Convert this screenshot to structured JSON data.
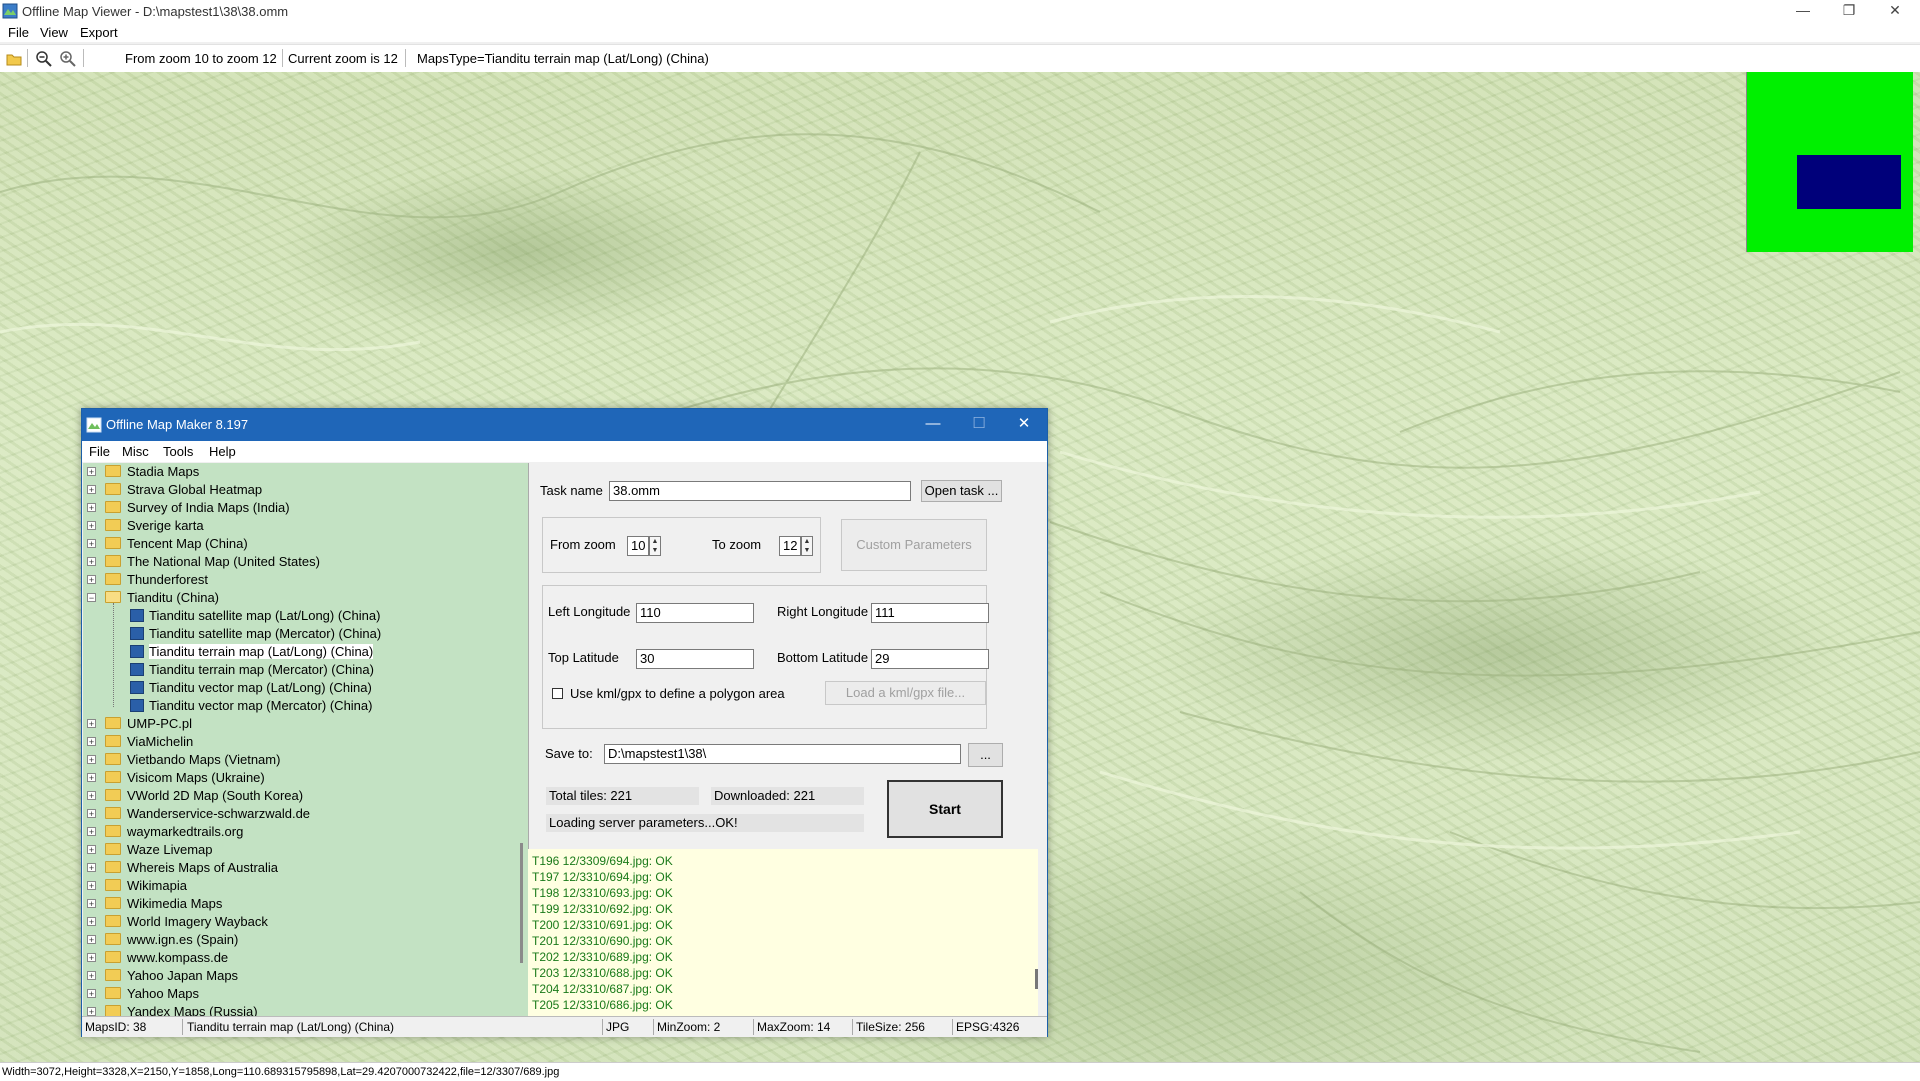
{
  "main_window": {
    "title": "Offline Map Viewer - D:\\mapstest1\\38\\38.omm",
    "menu": [
      "File",
      "View",
      "Export"
    ],
    "toolbar": {
      "zoom_range": "From zoom 10 to zoom 12",
      "current_zoom": "Current zoom is 12",
      "maps_type": "MapsType=Tianditu terrain map (Lat/Long) (China)"
    },
    "overview_colors": {
      "background": "#00f000",
      "viewport": "#00007a"
    },
    "status": "Width=3072,Height=3328,X=2150,Y=1858,Long=110.689315795898,Lat=29.4207000732422,file=12/3307/689.jpg",
    "window_buttons": {
      "minimize": "—",
      "restore": "❐",
      "close": "✕"
    }
  },
  "dialog": {
    "title": "Offline Map Maker 8.197",
    "menu": [
      "File",
      "Misc",
      "Tools",
      "Help"
    ],
    "window_buttons": {
      "minimize": "—",
      "maximize": "☐",
      "close": "✕"
    },
    "tree": [
      {
        "label": "Stadia Maps",
        "type": "folder",
        "expanded": false
      },
      {
        "label": "Strava Global Heatmap",
        "type": "folder",
        "expanded": false
      },
      {
        "label": "Survey of India Maps (India)",
        "type": "folder",
        "expanded": false
      },
      {
        "label": "Sverige karta",
        "type": "folder",
        "expanded": false
      },
      {
        "label": "Tencent Map (China)",
        "type": "folder",
        "expanded": false
      },
      {
        "label": "The National Map (United States)",
        "type": "folder",
        "expanded": false
      },
      {
        "label": "Thunderforest",
        "type": "folder",
        "expanded": false
      },
      {
        "label": "Tianditu (China)",
        "type": "folder",
        "expanded": true
      },
      {
        "label": "Tianditu satellite map (Lat/Long) (China)",
        "type": "map"
      },
      {
        "label": "Tianditu satellite map (Mercator) (China)",
        "type": "map"
      },
      {
        "label": "Tianditu terrain map (Lat/Long) (China)",
        "type": "map",
        "selected": true
      },
      {
        "label": "Tianditu terrain map (Mercator) (China)",
        "type": "map"
      },
      {
        "label": "Tianditu vector map (Lat/Long) (China)",
        "type": "map"
      },
      {
        "label": "Tianditu vector map (Mercator) (China)",
        "type": "map"
      },
      {
        "label": "UMP-PC.pl",
        "type": "folder",
        "expanded": false
      },
      {
        "label": "ViaMichelin",
        "type": "folder",
        "expanded": false
      },
      {
        "label": "Vietbando Maps (Vietnam)",
        "type": "folder",
        "expanded": false
      },
      {
        "label": "Visicom Maps (Ukraine)",
        "type": "folder",
        "expanded": false
      },
      {
        "label": "VWorld 2D Map (South Korea)",
        "type": "folder",
        "expanded": false
      },
      {
        "label": "Wanderservice-schwarzwald.de",
        "type": "folder",
        "expanded": false
      },
      {
        "label": "waymarkedtrails.org",
        "type": "folder",
        "expanded": false
      },
      {
        "label": "Waze Livemap",
        "type": "folder",
        "expanded": false
      },
      {
        "label": "Whereis Maps of Australia",
        "type": "folder",
        "expanded": false
      },
      {
        "label": "Wikimapia",
        "type": "folder",
        "expanded": false
      },
      {
        "label": "Wikimedia Maps",
        "type": "folder",
        "expanded": false
      },
      {
        "label": "World Imagery Wayback",
        "type": "folder",
        "expanded": false
      },
      {
        "label": "www.ign.es (Spain)",
        "type": "folder",
        "expanded": false
      },
      {
        "label": "www.kompass.de",
        "type": "folder",
        "expanded": false
      },
      {
        "label": "Yahoo Japan Maps",
        "type": "folder",
        "expanded": false
      },
      {
        "label": "Yahoo Maps",
        "type": "folder",
        "expanded": false
      },
      {
        "label": "Yandex Maps (Russia)",
        "type": "folder",
        "expanded": false
      }
    ],
    "task": {
      "label": "Task name",
      "value": "38.omm",
      "open_button": "Open task ..."
    },
    "zoom": {
      "from_label": "From zoom",
      "from_value": "10",
      "to_label": "To zoom",
      "to_value": "12",
      "custom_button": "Custom Parameters"
    },
    "coords": {
      "left_lon_label": "Left Longitude",
      "left_lon": "110",
      "right_lon_label": "Right Longitude",
      "right_lon": "111",
      "top_lat_label": "Top Latitude",
      "top_lat": "30",
      "bottom_lat_label": "Bottom Latitude",
      "bottom_lat": "29",
      "kml_checkbox": "Use kml/gpx to define a polygon area",
      "kml_checked": false,
      "load_kml_button": "Load a kml/gpx file..."
    },
    "save": {
      "label": "Save to:",
      "value": "D:\\mapstest1\\38\\",
      "browse_button": "..."
    },
    "progress": {
      "total": "Total tiles: 221",
      "downloaded": "Downloaded: 221",
      "message": "Loading server parameters...OK!",
      "start_button": "Start"
    },
    "log": [
      "T196 12/3309/694.jpg: OK",
      "T197 12/3310/694.jpg: OK",
      "T198 12/3310/693.jpg: OK",
      "T199 12/3310/692.jpg: OK",
      "T200 12/3310/691.jpg: OK",
      "T201 12/3310/690.jpg: OK",
      "T202 12/3310/689.jpg: OK",
      "T203 12/3310/688.jpg: OK",
      "T204 12/3310/687.jpg: OK",
      "T205 12/3310/686.jpg: OK"
    ],
    "status": {
      "maps_id": "MapsID: 38",
      "maps_name": "Tianditu terrain map (Lat/Long) (China)",
      "format": "JPG",
      "min_zoom": "MinZoom: 2",
      "max_zoom": "MaxZoom: 14",
      "tile_size": "TileSize: 256",
      "epsg": "EPSG:4326"
    }
  }
}
